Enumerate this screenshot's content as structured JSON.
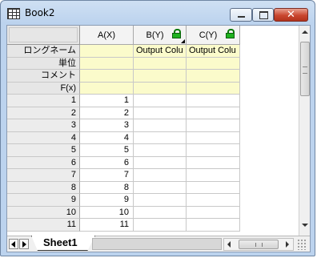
{
  "window": {
    "title": "Book2",
    "close_glyph": "✕"
  },
  "icons": [
    "grid-app-icon",
    "minimize-icon",
    "maximize-icon",
    "close-icon",
    "lock-icon"
  ],
  "columns": [
    {
      "header": "A(X)",
      "locked": false,
      "sort_marker": false
    },
    {
      "header": "B(Y)",
      "locked": true,
      "sort_marker": true
    },
    {
      "header": "C(Y)",
      "locked": true,
      "sort_marker": false
    }
  ],
  "meta_rows": [
    {
      "label": "ロングネーム",
      "values": [
        "",
        "Output Colu",
        "Output Colu"
      ]
    },
    {
      "label": "単位",
      "values": [
        "",
        "",
        ""
      ]
    },
    {
      "label": "コメント",
      "values": [
        "",
        "",
        ""
      ]
    },
    {
      "label": "F(x)",
      "values": [
        "",
        "",
        ""
      ]
    }
  ],
  "data_rows": [
    {
      "num": "1",
      "values": [
        "1",
        "",
        ""
      ]
    },
    {
      "num": "2",
      "values": [
        "2",
        "",
        ""
      ]
    },
    {
      "num": "3",
      "values": [
        "3",
        "",
        ""
      ]
    },
    {
      "num": "4",
      "values": [
        "4",
        "",
        ""
      ]
    },
    {
      "num": "5",
      "values": [
        "5",
        "",
        ""
      ]
    },
    {
      "num": "6",
      "values": [
        "6",
        "",
        ""
      ]
    },
    {
      "num": "7",
      "values": [
        "7",
        "",
        ""
      ]
    },
    {
      "num": "8",
      "values": [
        "8",
        "",
        ""
      ]
    },
    {
      "num": "9",
      "values": [
        "9",
        "",
        ""
      ]
    },
    {
      "num": "10",
      "values": [
        "10",
        "",
        ""
      ]
    },
    {
      "num": "11",
      "values": [
        "11",
        "",
        ""
      ]
    }
  ],
  "sheet_tabs": [
    {
      "label": "Sheet1",
      "active": true
    }
  ],
  "colors": {
    "meta_row_bg": "#fbfbcb",
    "lock_green": "#1fb21f",
    "close_red": "#c9472f"
  }
}
